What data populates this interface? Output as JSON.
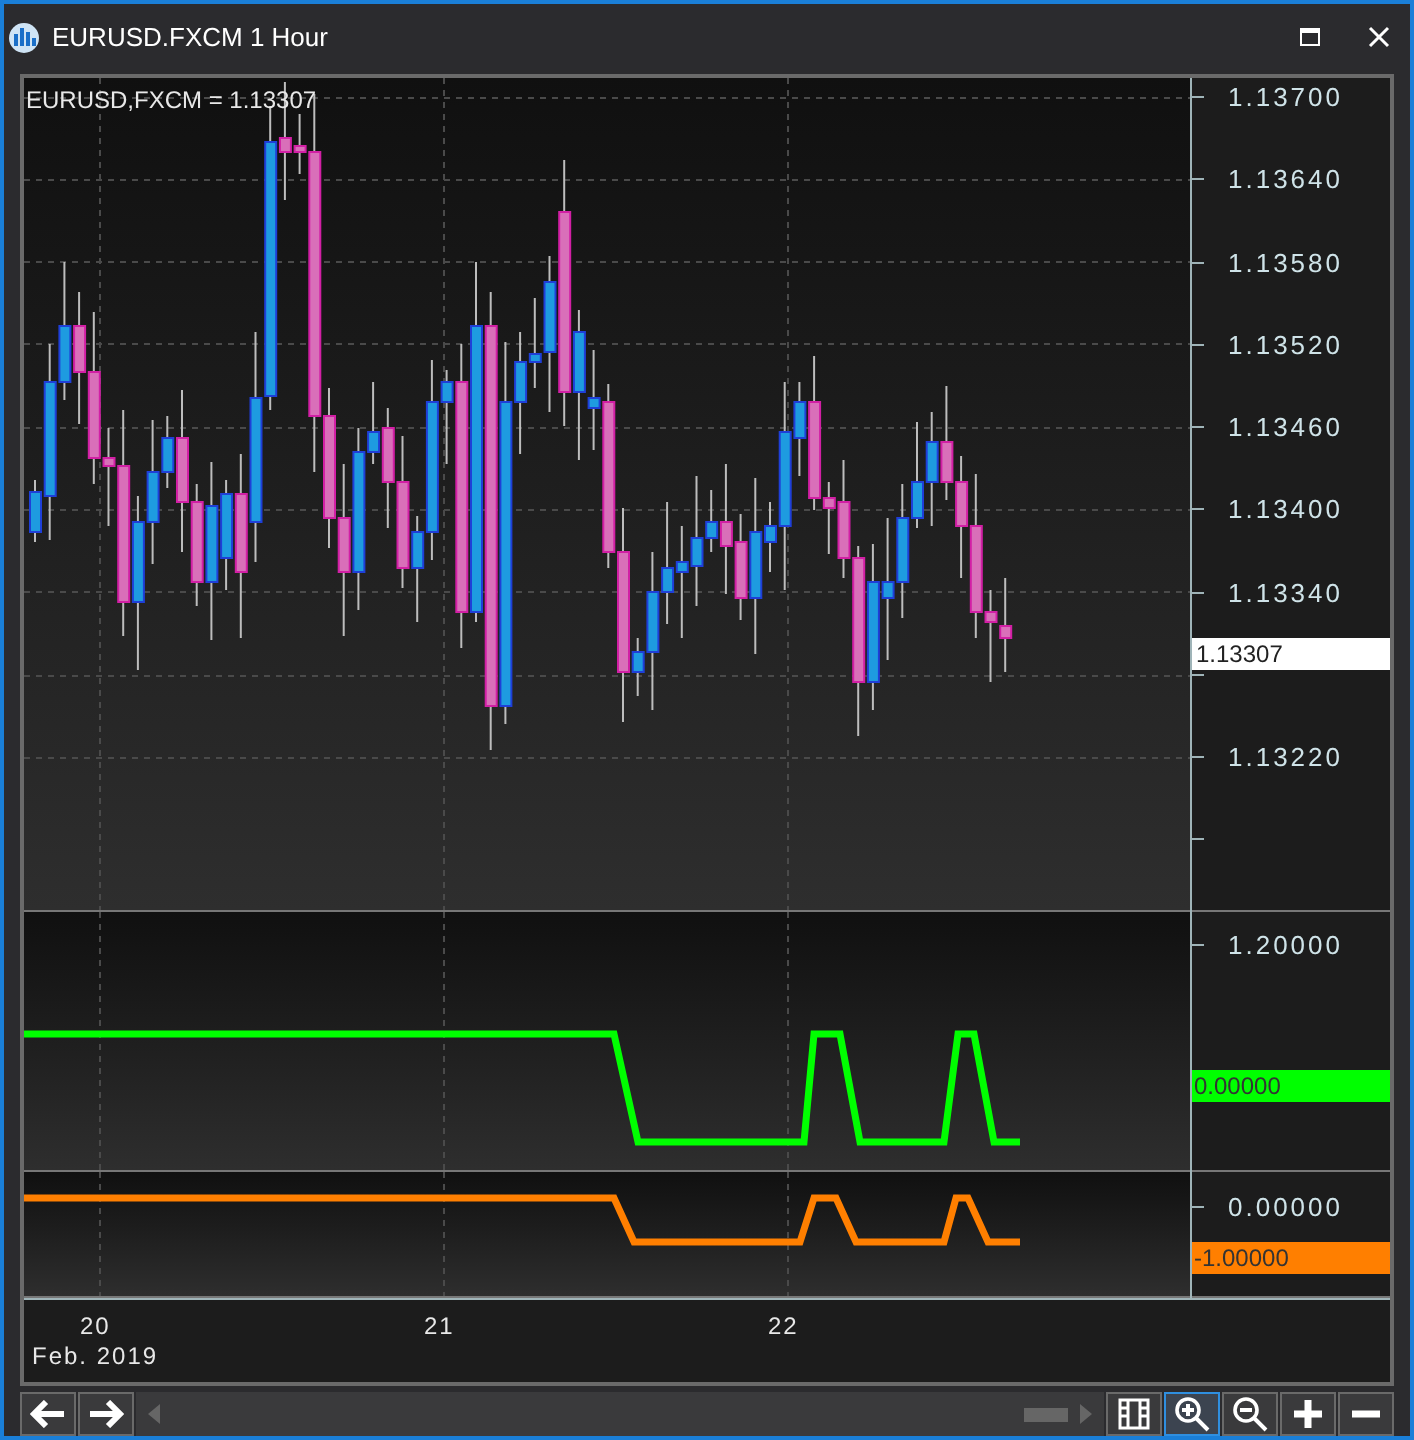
{
  "window": {
    "title": "EURUSD.FXCM 1 Hour"
  },
  "chart": {
    "legend": "EURUSD,FXCM = 1.13307",
    "price_axis": {
      "ticks": [
        "1.13700",
        "1.13640",
        "1.13580",
        "1.13520",
        "1.13460",
        "1.13400",
        "1.13340",
        "1.13220"
      ],
      "current_value": "1.13307"
    },
    "indicators": [
      {
        "ticks": [
          "1.20000"
        ],
        "current_value": "0.00000",
        "color": "#00ff00"
      },
      {
        "ticks": [
          "0.00000"
        ],
        "current_value": "-1.00000",
        "color": "#ff7f00"
      }
    ],
    "time_axis": {
      "days": [
        "20",
        "21",
        "22"
      ],
      "month": "Feb. 2019"
    }
  },
  "toolbar": {
    "buttons": [
      {
        "kind": "back",
        "selected": false
      },
      {
        "kind": "forward",
        "selected": false
      },
      {
        "kind": "fit",
        "selected": false
      },
      {
        "kind": "zoom-in",
        "selected": true
      },
      {
        "kind": "zoom-out",
        "selected": false
      },
      {
        "kind": "plus",
        "selected": false
      },
      {
        "kind": "minus",
        "selected": false
      }
    ]
  }
}
